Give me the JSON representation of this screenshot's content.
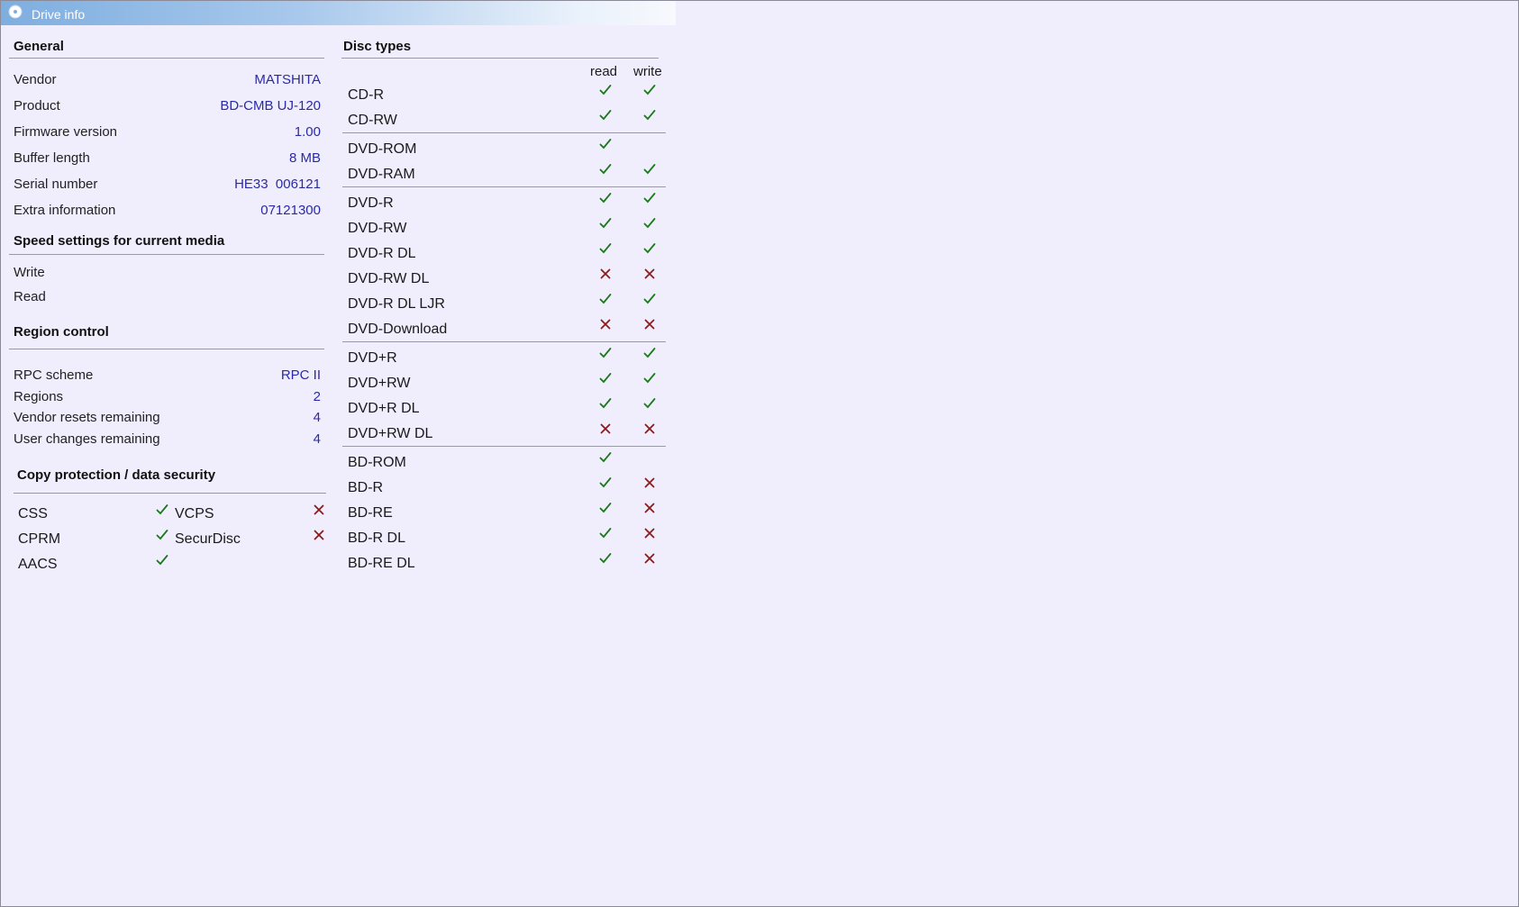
{
  "window": {
    "title": "Drive info",
    "icon": "disc-icon"
  },
  "general": {
    "title": "General",
    "rows": [
      {
        "label": "Vendor",
        "value": "MATSHITA"
      },
      {
        "label": "Product",
        "value": "BD-CMB UJ-120"
      },
      {
        "label": "Firmware version",
        "value": "1.00"
      },
      {
        "label": "Buffer length",
        "value": "8 MB"
      },
      {
        "label": "Serial number",
        "value": "HE33  006121"
      },
      {
        "label": "Extra information",
        "value": "07121300"
      }
    ]
  },
  "speed": {
    "title": "Speed settings for current media",
    "rows": [
      {
        "label": "Write"
      },
      {
        "label": "Read"
      }
    ]
  },
  "region": {
    "title": "Region control",
    "rows": [
      {
        "label": "RPC scheme",
        "value": "RPC II"
      },
      {
        "label": "Regions",
        "value": "2"
      },
      {
        "label": "Vendor resets remaining",
        "value": "4"
      },
      {
        "label": "User changes remaining",
        "value": "4"
      }
    ]
  },
  "copy_protection": {
    "title": "Copy protection / data security",
    "items": [
      {
        "name": "CSS",
        "supported": true
      },
      {
        "name": "CPRM",
        "supported": true
      },
      {
        "name": "AACS",
        "supported": true
      },
      {
        "name": "VCPS",
        "supported": false
      },
      {
        "name": "SecurDisc",
        "supported": false
      }
    ]
  },
  "disc_types": {
    "title": "Disc types",
    "read_header": "read",
    "write_header": "write",
    "groups": [
      [
        {
          "name": "CD-R",
          "read": "yes",
          "write": "yes"
        },
        {
          "name": "CD-RW",
          "read": "yes",
          "write": "yes"
        }
      ],
      [
        {
          "name": "DVD-ROM",
          "read": "yes",
          "write": "none"
        },
        {
          "name": "DVD-RAM",
          "read": "yes",
          "write": "yes"
        }
      ],
      [
        {
          "name": "DVD-R",
          "read": "yes",
          "write": "yes"
        },
        {
          "name": "DVD-RW",
          "read": "yes",
          "write": "yes"
        },
        {
          "name": "DVD-R DL",
          "read": "yes",
          "write": "yes"
        },
        {
          "name": "DVD-RW DL",
          "read": "no",
          "write": "no"
        },
        {
          "name": "DVD-R DL LJR",
          "read": "yes",
          "write": "yes"
        },
        {
          "name": "DVD-Download",
          "read": "no",
          "write": "no"
        }
      ],
      [
        {
          "name": "DVD+R",
          "read": "yes",
          "write": "yes"
        },
        {
          "name": "DVD+RW",
          "read": "yes",
          "write": "yes"
        },
        {
          "name": "DVD+R DL",
          "read": "yes",
          "write": "yes"
        },
        {
          "name": "DVD+RW DL",
          "read": "no",
          "write": "no"
        }
      ],
      [
        {
          "name": "BD-ROM",
          "read": "yes",
          "write": "none"
        },
        {
          "name": "BD-R",
          "read": "yes",
          "write": "no"
        },
        {
          "name": "BD-RE",
          "read": "yes",
          "write": "no"
        },
        {
          "name": "BD-R DL",
          "read": "yes",
          "write": "no"
        },
        {
          "name": "BD-RE DL",
          "read": "yes",
          "write": "no"
        }
      ]
    ]
  },
  "colors": {
    "check": "#1a7a1a",
    "cross": "#8b1a1a",
    "value_text": "#2a2aa6"
  }
}
